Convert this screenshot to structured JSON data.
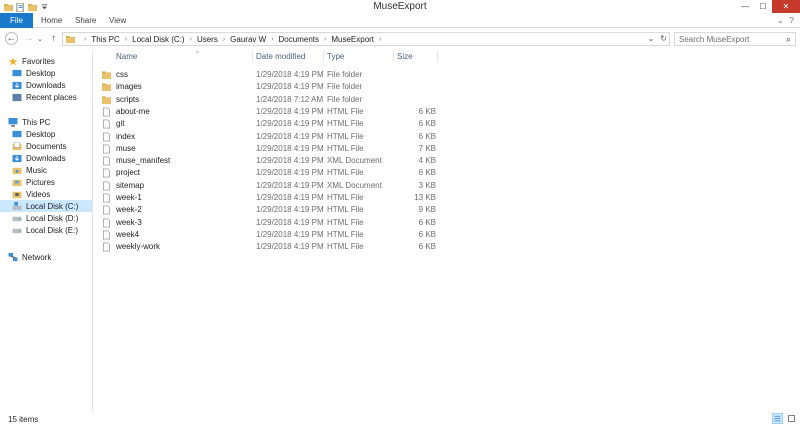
{
  "window": {
    "title": "MuseExport",
    "minimize": "—",
    "maximize": "☐",
    "close": "✕"
  },
  "ribbon": {
    "tabs": [
      "File",
      "Home",
      "Share",
      "View"
    ],
    "expand": "⌄",
    "help": "?"
  },
  "nav": {
    "back": "←",
    "forward": "→",
    "history": "⌄",
    "up": "↑"
  },
  "address": {
    "crumbs": [
      "This PC",
      "Local Disk (C:)",
      "Users",
      "Gaurav W",
      "Documents",
      "MuseExport"
    ],
    "dropdown": "⌄",
    "refresh": "↻"
  },
  "search": {
    "placeholder": "Search MuseExport",
    "icon": "⌕"
  },
  "sidebar": {
    "favorites": {
      "label": "Favorites",
      "items": [
        "Desktop",
        "Downloads",
        "Recent places"
      ]
    },
    "this_pc": {
      "label": "This PC",
      "items": [
        "Desktop",
        "Documents",
        "Downloads",
        "Music",
        "Pictures",
        "Videos",
        "Local Disk (C:)",
        "Local Disk (D:)",
        "Local Disk (E:)"
      ]
    },
    "network": {
      "label": "Network"
    },
    "selected": "Local Disk (C:)"
  },
  "columns": {
    "name": "Name",
    "date": "Date modified",
    "type": "Type",
    "size": "Size",
    "sort_indicator": "^"
  },
  "files": [
    {
      "name": "css",
      "date": "1/29/2018 4:19 PM",
      "type": "File folder",
      "size": "",
      "kind": "folder"
    },
    {
      "name": "images",
      "date": "1/29/2018 4:19 PM",
      "type": "File folder",
      "size": "",
      "kind": "folder"
    },
    {
      "name": "scripts",
      "date": "1/24/2018 7:12 AM",
      "type": "File folder",
      "size": "",
      "kind": "folder"
    },
    {
      "name": "about-me",
      "date": "1/29/2018 4:19 PM",
      "type": "HTML File",
      "size": "6 KB",
      "kind": "file"
    },
    {
      "name": "git",
      "date": "1/29/2018 4:19 PM",
      "type": "HTML File",
      "size": "6 KB",
      "kind": "file"
    },
    {
      "name": "index",
      "date": "1/29/2018 4:19 PM",
      "type": "HTML File",
      "size": "6 KB",
      "kind": "file"
    },
    {
      "name": "muse",
      "date": "1/29/2018 4:19 PM",
      "type": "HTML File",
      "size": "7 KB",
      "kind": "file"
    },
    {
      "name": "muse_manifest",
      "date": "1/29/2018 4:19 PM",
      "type": "XML Document",
      "size": "4 KB",
      "kind": "file"
    },
    {
      "name": "project",
      "date": "1/29/2018 4:19 PM",
      "type": "HTML File",
      "size": "6 KB",
      "kind": "file"
    },
    {
      "name": "sitemap",
      "date": "1/29/2018 4:19 PM",
      "type": "XML Document",
      "size": "3 KB",
      "kind": "file"
    },
    {
      "name": "week-1",
      "date": "1/29/2018 4:19 PM",
      "type": "HTML File",
      "size": "13 KB",
      "kind": "file"
    },
    {
      "name": "week-2",
      "date": "1/29/2018 4:19 PM",
      "type": "HTML File",
      "size": "9 KB",
      "kind": "file"
    },
    {
      "name": "week-3",
      "date": "1/29/2018 4:19 PM",
      "type": "HTML File",
      "size": "6 KB",
      "kind": "file"
    },
    {
      "name": "week4",
      "date": "1/29/2018 4:19 PM",
      "type": "HTML File",
      "size": "6 KB",
      "kind": "file"
    },
    {
      "name": "weekly-work",
      "date": "1/29/2018 4:19 PM",
      "type": "HTML File",
      "size": "6 KB",
      "kind": "file"
    }
  ],
  "status": {
    "item_count": "15 items"
  },
  "colors": {
    "accent": "#1979ca",
    "selection": "#cce8ff",
    "folder": "#e8c26a",
    "close": "#c7392b"
  },
  "icons": {
    "folder": "folder-icon",
    "file": "file-icon",
    "star": "star-icon",
    "pc": "computer-icon",
    "drive": "drive-icon",
    "network": "network-icon"
  }
}
